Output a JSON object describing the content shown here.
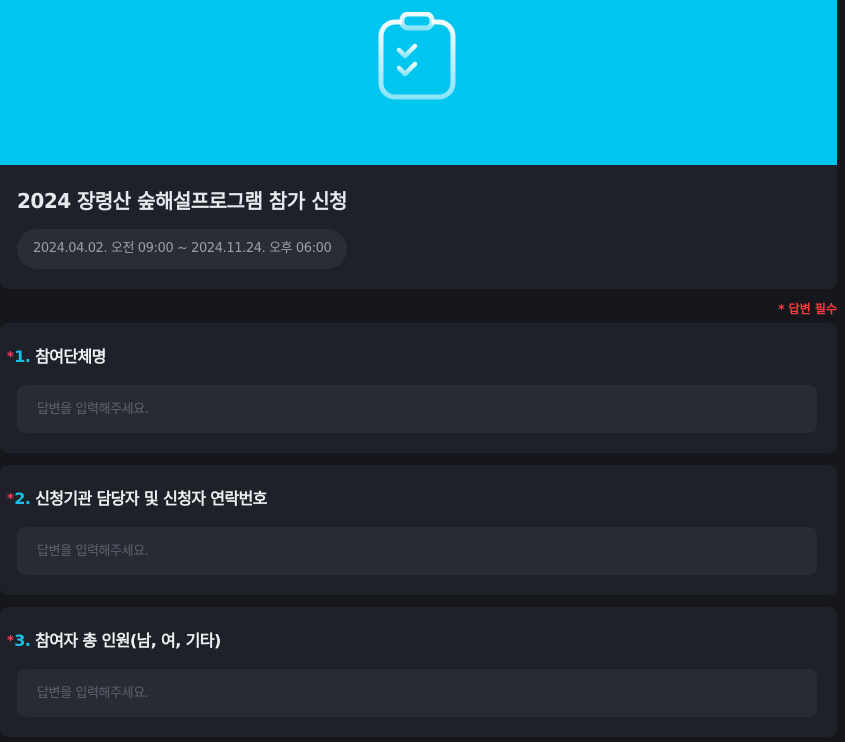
{
  "header": {
    "icon": "clipboard-checklist-icon",
    "title": "2024 장령산 숲해설프로그램 참가 신청",
    "period": "2024.04.02. 오전 09:00 ~ 2024.11.24. 오후 06:00"
  },
  "required_note": "* 답변 필수",
  "questions": [
    {
      "star": "*",
      "number": "1.",
      "label": "참여단체명",
      "placeholder": "답변을 입력해주세요.",
      "value": ""
    },
    {
      "star": "*",
      "number": "2.",
      "label": "신청기관 담당자 및 신청자 연락번호",
      "placeholder": "답변을 입력해주세요.",
      "value": ""
    },
    {
      "star": "*",
      "number": "3.",
      "label": "참여자 총 인원(남, 여, 기타)",
      "placeholder": "답변을 입력해주세요.",
      "value": ""
    }
  ],
  "colors": {
    "banner": "#00c5ee",
    "card": "#1f2129",
    "background": "#15171d",
    "accent": "#19bfe6",
    "required": "#ff3b3b"
  }
}
